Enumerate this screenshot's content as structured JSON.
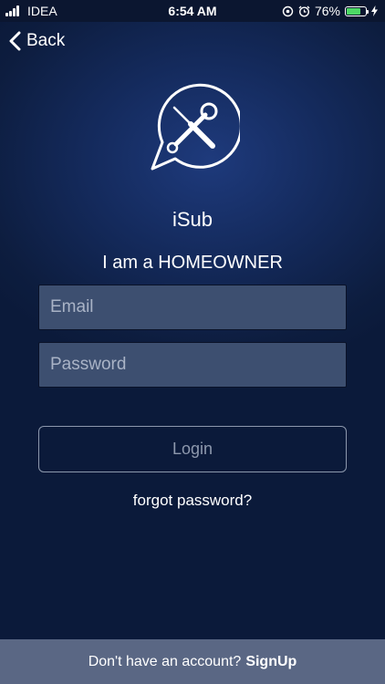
{
  "status_bar": {
    "carrier": "IDEA",
    "time": "6:54 AM",
    "battery_text": "76%",
    "battery_level": 0.76,
    "battery_color": "#4cd964"
  },
  "nav": {
    "back_label": "Back",
    "back_icon": "chevron-left-icon"
  },
  "logo": {
    "icon": "tools-chat-bubble-icon"
  },
  "app_name": "iSub",
  "role_title": "I am a HOMEOWNER",
  "form": {
    "email_placeholder": "Email",
    "email_value": "",
    "password_placeholder": "Password",
    "password_value": "",
    "login_label": "Login"
  },
  "forgot_password": "forgot password?",
  "footer": {
    "prompt": "Don't have an account?",
    "signup_label": "SignUp"
  },
  "colors": {
    "background": "#0d1d3f",
    "field_fill": "#3d4f70",
    "footer": "#5a6784"
  }
}
